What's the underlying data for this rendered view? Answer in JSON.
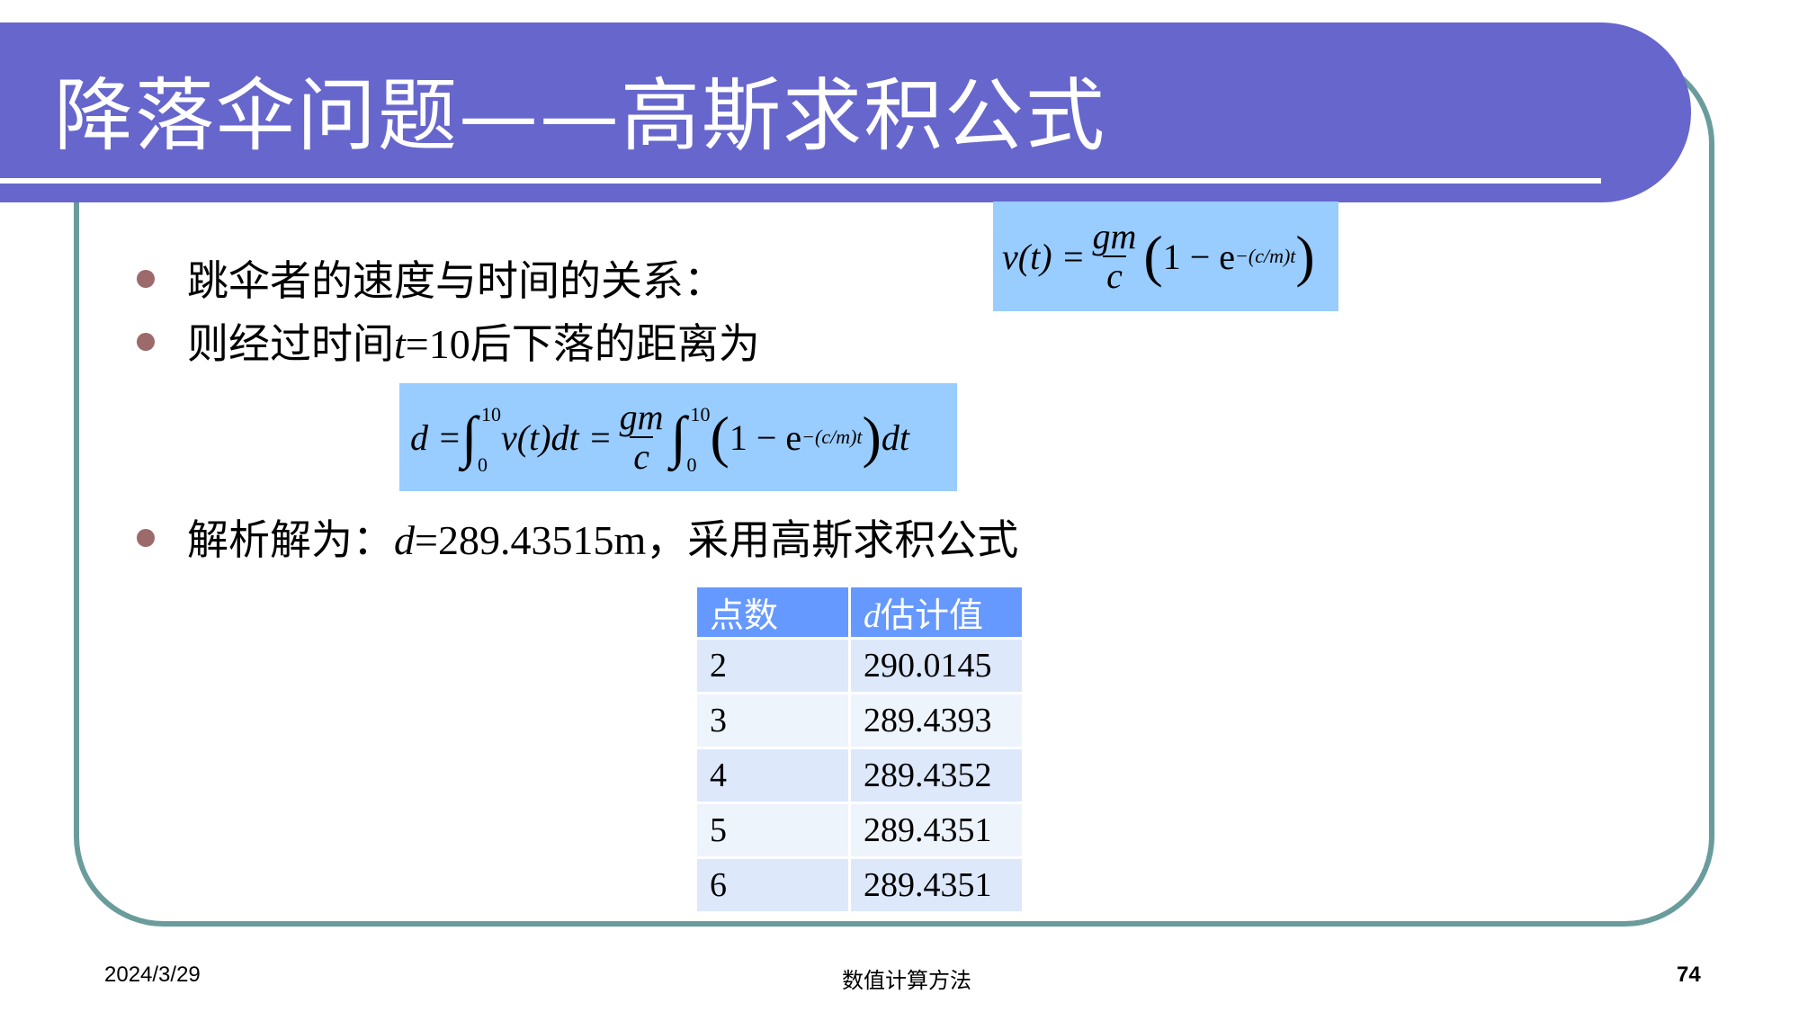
{
  "title": "降落伞问题——高斯求积公式",
  "bullets": [
    {
      "text": "跳伞者的速度与时间的关系："
    },
    {
      "pre": "则经过时间",
      "var": "t",
      "post": "=10后下落的距离为"
    },
    {
      "pre": "解析解为：",
      "var": "d",
      "post": "=289.43515m，采用高斯求积公式"
    }
  ],
  "eq1": {
    "lhs": "v(t) =",
    "num": "gm",
    "den": "c",
    "one_minus": "1 − e",
    "exp": "−(c/m)t"
  },
  "eq2": {
    "lhs": "d =",
    "int_upper": "10",
    "int_lower": "0",
    "integrand": "v(t)dt =",
    "num": "gm",
    "den": "c",
    "one_minus": "1 − e",
    "exp": "−(c/m)t",
    "dt": "dt"
  },
  "table": {
    "header_points": "点数",
    "header_var": "d",
    "header_estimate": "估计值",
    "rows": [
      {
        "points": "2",
        "value": "290.0145"
      },
      {
        "points": "3",
        "value": "289.4393"
      },
      {
        "points": "4",
        "value": "289.4352"
      },
      {
        "points": "5",
        "value": "289.4351"
      },
      {
        "points": "6",
        "value": "289.4351"
      }
    ]
  },
  "footer": {
    "date": "2024/3/29",
    "course": "数值计算方法",
    "page": "74"
  },
  "colors": {
    "title_bar": "#6666cc",
    "frame": "#6a9c9c",
    "eq_bg": "#99ccff",
    "table_header": "#6699ff",
    "bullet": "#9c6a6a"
  }
}
